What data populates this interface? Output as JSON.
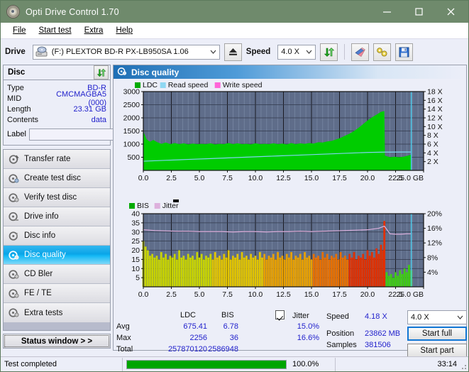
{
  "window": {
    "title": "Opti Drive Control 1.70",
    "icon": "disc-icon",
    "minimize": "minimize-icon",
    "maximize": "maximize-icon",
    "close": "close-icon"
  },
  "menu": {
    "items": [
      {
        "label": "File"
      },
      {
        "label": "Start test"
      },
      {
        "label": "Extra"
      },
      {
        "label": "Help"
      }
    ]
  },
  "toolbar": {
    "drive_label": "Drive",
    "drive_value": "(F:)   PLEXTOR BD-R  PX-LB950SA 1.06",
    "eject_title": "eject-button",
    "speed_label": "Speed",
    "speed_value": "4.0 X",
    "refresh_title": "refresh-button",
    "erase_title": "erase-button",
    "tools_title": "tools-button",
    "save_title": "save-button"
  },
  "disc": {
    "group_title": "Disc",
    "rows": [
      {
        "key": "Type",
        "value": "BD-R"
      },
      {
        "key": "MID",
        "value": "CMCMAGBA5 (000)"
      },
      {
        "key": "Length",
        "value": "23.31 GB"
      },
      {
        "key": "Contents",
        "value": "data"
      }
    ],
    "label_key": "Label",
    "label_value": "",
    "label_placeholder": ""
  },
  "sidebar": {
    "items": [
      {
        "label": "Transfer rate",
        "active": false
      },
      {
        "label": "Create test disc",
        "active": false
      },
      {
        "label": "Verify test disc",
        "active": false
      },
      {
        "label": "Drive info",
        "active": false
      },
      {
        "label": "Disc info",
        "active": false
      },
      {
        "label": "Disc quality",
        "active": true
      },
      {
        "label": "CD Bler",
        "active": false
      },
      {
        "label": "FE / TE",
        "active": false
      },
      {
        "label": "Extra tests",
        "active": false
      }
    ],
    "status_window": "Status window > >"
  },
  "panel": {
    "title": "Disc quality"
  },
  "stats": {
    "col_ldc": "LDC",
    "col_bis": "BIS",
    "jitter_label": "Jitter",
    "jitter_checked": true,
    "rows": [
      {
        "key": "Avg",
        "ldc": "675.41",
        "bis": "6.78",
        "jitter": "15.0%"
      },
      {
        "key": "Max",
        "ldc": "2256",
        "bis": "36",
        "jitter": "16.6%"
      },
      {
        "key": "Total",
        "ldc": "257870120",
        "bis": "2586948",
        "jitter": ""
      }
    ],
    "speed_key": "Speed",
    "speed_value": "4.18 X",
    "position_key": "Position",
    "position_value": "23862 MB",
    "samples_key": "Samples",
    "samples_value": "381506",
    "speed_select": "4.0 X",
    "start_full": "Start full",
    "start_part": "Start part"
  },
  "statusbar": {
    "message": "Test completed",
    "percent_text": "100.0%",
    "percent_value": 100,
    "elapsed": "33:14"
  },
  "colors": {
    "titlebar": "#6f8a6c",
    "ldc_green": "#00cc00",
    "read_speed": "#7fd4f0",
    "write_speed": "#ff66d0",
    "jitter_pink": "#ddb0dd",
    "plot_bg": "#5f6d8a",
    "accent_blue": "#2222cc",
    "progress_green": "#00a500"
  },
  "chart_data": [
    {
      "type": "area",
      "id": "ldc-chart",
      "title": "Disc quality",
      "xlabel": "GB",
      "ylabel": "LDC",
      "xlim": [
        0.0,
        25.0
      ],
      "xticks": [
        "0.0",
        "2.5",
        "5.0",
        "7.5",
        "10.0",
        "12.5",
        "15.0",
        "17.5",
        "20.0",
        "22.5",
        "25.0 GB"
      ],
      "ylim": [
        0,
        3000
      ],
      "yticks": [
        "500",
        "1000",
        "1500",
        "2000",
        "2500",
        "3000"
      ],
      "y2lim": [
        0,
        18
      ],
      "y2ticks": [
        "2 X",
        "4 X",
        "6 X",
        "8 X",
        "10 X",
        "12 X",
        "14 X",
        "16 X",
        "18 X"
      ],
      "grid": true,
      "legend": [
        {
          "name": "LDC",
          "color": "#00aa00"
        },
        {
          "name": "Read speed",
          "color": "#8fd8f2"
        },
        {
          "name": "Write speed",
          "color": "#ff66d8"
        }
      ],
      "series": [
        {
          "name": "LDC",
          "kind": "area",
          "color": "#00cc00",
          "x": [
            0.0,
            0.3,
            0.6,
            0.9,
            1.2,
            1.6,
            2.0,
            2.4,
            2.8,
            3.2,
            3.6,
            4.0,
            4.4,
            4.8,
            5.2,
            5.6,
            6.0,
            6.4,
            6.8,
            7.2,
            7.6,
            8.0,
            8.4,
            8.8,
            9.2,
            9.6,
            10.0,
            10.4,
            10.8,
            11.2,
            11.6,
            12.0,
            12.4,
            12.8,
            13.2,
            13.6,
            14.0,
            14.4,
            14.8,
            15.2,
            15.6,
            16.0,
            16.4,
            16.8,
            17.2,
            17.6,
            18.0,
            18.4,
            18.8,
            19.2,
            19.6,
            20.0,
            20.4,
            20.8,
            21.2,
            21.5,
            21.55,
            22.0,
            22.4,
            22.8,
            23.2,
            23.6,
            23.9
          ],
          "y": [
            1480,
            1180,
            1090,
            1160,
            1080,
            1010,
            1060,
            1000,
            1040,
            1000,
            1030,
            990,
            1020,
            1000,
            1010,
            1000,
            1030,
            990,
            1010,
            1000,
            1040,
            1000,
            1030,
            1000,
            1010,
            990,
            1030,
            1000,
            1010,
            1000,
            1030,
            1000,
            1020,
            990,
            1040,
            1000,
            1030,
            1010,
            1040,
            1020,
            1070,
            1060,
            1100,
            1120,
            1180,
            1240,
            1320,
            1400,
            1500,
            1620,
            1760,
            1900,
            2020,
            2120,
            2230,
            2256,
            560,
            500,
            520,
            500,
            520,
            560,
            600
          ]
        },
        {
          "name": "Read speed",
          "kind": "line",
          "color": "#7fd4f0",
          "units": "X",
          "x": [
            0.0,
            2.0,
            4.0,
            6.0,
            8.0,
            10.0,
            12.0,
            14.0,
            16.0,
            18.0,
            20.0,
            21.5,
            22.0,
            23.0,
            23.9
          ],
          "y": [
            2.1,
            2.3,
            2.5,
            2.7,
            2.9,
            3.1,
            3.3,
            3.5,
            3.7,
            3.9,
            4.1,
            4.18,
            4.18,
            4.2,
            4.2
          ]
        }
      ],
      "cursor_x": 23.9
    },
    {
      "type": "bar",
      "id": "bis-chart",
      "xlabel": "GB",
      "ylabel": "BIS",
      "xlim": [
        0.0,
        25.0
      ],
      "xticks": [
        "0.0",
        "2.5",
        "5.0",
        "7.5",
        "10.0",
        "12.5",
        "15.0",
        "17.5",
        "20.0",
        "22.5",
        "25.0 GB"
      ],
      "ylim": [
        0,
        40
      ],
      "yticks": [
        "5",
        "10",
        "15",
        "20",
        "25",
        "30",
        "35",
        "40"
      ],
      "y2lim": [
        0,
        20
      ],
      "y2ticks": [
        "4%",
        "8%",
        "12%",
        "16%",
        "20%"
      ],
      "grid": true,
      "legend": [
        {
          "name": "BIS",
          "color": "#00aa00"
        },
        {
          "name": "Jitter",
          "color": "#ddb0dd"
        }
      ],
      "series": [
        {
          "name": "BIS",
          "kind": "bar",
          "x": [
            0.0,
            0.2,
            0.4,
            0.6,
            0.8,
            1.0,
            1.2,
            1.4,
            1.6,
            1.8,
            2.0,
            2.2,
            2.4,
            2.6,
            2.8,
            3.0,
            3.2,
            3.4,
            3.6,
            3.8,
            4.0,
            4.2,
            4.4,
            4.6,
            4.8,
            5.0,
            5.2,
            5.4,
            5.6,
            5.8,
            6.0,
            6.2,
            6.4,
            6.6,
            6.8,
            7.0,
            7.2,
            7.4,
            7.6,
            7.8,
            8.0,
            8.2,
            8.4,
            8.6,
            8.8,
            9.0,
            9.2,
            9.4,
            9.6,
            9.8,
            10.0,
            10.2,
            10.4,
            10.6,
            10.8,
            11.0,
            11.2,
            11.4,
            11.6,
            11.8,
            12.0,
            12.2,
            12.4,
            12.6,
            12.8,
            13.0,
            13.2,
            13.4,
            13.6,
            13.8,
            14.0,
            14.2,
            14.4,
            14.6,
            14.8,
            15.0,
            15.2,
            15.4,
            15.6,
            15.8,
            16.0,
            16.2,
            16.4,
            16.6,
            16.8,
            17.0,
            17.2,
            17.4,
            17.6,
            17.8,
            18.0,
            18.2,
            18.4,
            18.6,
            18.8,
            19.0,
            19.2,
            19.4,
            19.6,
            19.8,
            20.0,
            20.2,
            20.4,
            20.6,
            20.8,
            21.0,
            21.2,
            21.4,
            21.5,
            21.7,
            21.9,
            22.1,
            22.3,
            22.5,
            22.7,
            22.9,
            23.1,
            23.3,
            23.5,
            23.7,
            23.9
          ],
          "y": [
            25,
            22,
            20,
            17,
            18,
            16,
            17,
            15,
            19,
            16,
            18,
            15,
            17,
            16,
            18,
            15,
            20,
            16,
            17,
            15,
            18,
            16,
            17,
            15,
            19,
            16,
            18,
            15,
            17,
            16,
            18,
            15,
            19,
            16,
            17,
            15,
            18,
            16,
            20,
            15,
            17,
            16,
            18,
            15,
            19,
            16,
            17,
            15,
            18,
            16,
            17,
            15,
            19,
            16,
            18,
            15,
            17,
            16,
            18,
            15,
            19,
            16,
            17,
            15,
            18,
            16,
            19,
            15,
            17,
            16,
            18,
            15,
            19,
            16,
            17,
            15,
            18,
            16,
            17,
            15,
            19,
            16,
            18,
            15,
            17,
            16,
            18,
            15,
            19,
            16,
            17,
            15,
            18,
            16,
            19,
            15,
            17,
            16,
            18,
            15,
            20,
            17,
            19,
            16,
            21,
            18,
            23,
            20,
            36,
            8,
            6,
            7,
            5,
            8,
            6,
            9,
            7,
            10,
            8,
            12,
            9
          ],
          "note": "bar color gradient green->yellow->orange->red with rising severity, resetting to green after 21.5 GB"
        },
        {
          "name": "Jitter",
          "kind": "line",
          "color": "#ddb0dd",
          "units": "%",
          "x": [
            0.0,
            1.0,
            2.0,
            3.0,
            4.0,
            5.0,
            6.0,
            7.0,
            8.0,
            9.0,
            10.0,
            11.0,
            12.0,
            13.0,
            14.0,
            15.0,
            16.0,
            17.0,
            18.0,
            19.0,
            20.0,
            21.0,
            21.5,
            22.0,
            22.5,
            23.0,
            23.5,
            23.9
          ],
          "y": [
            15.6,
            15.4,
            15.3,
            15.2,
            15.2,
            15.1,
            15.1,
            15.1,
            15.0,
            15.1,
            15.1,
            15.0,
            15.1,
            15.1,
            15.2,
            15.1,
            15.2,
            15.3,
            15.4,
            15.5,
            15.6,
            16.0,
            16.6,
            14.5,
            14.4,
            14.4,
            14.5,
            14.5
          ]
        }
      ],
      "cursor_x": 23.9
    }
  ]
}
